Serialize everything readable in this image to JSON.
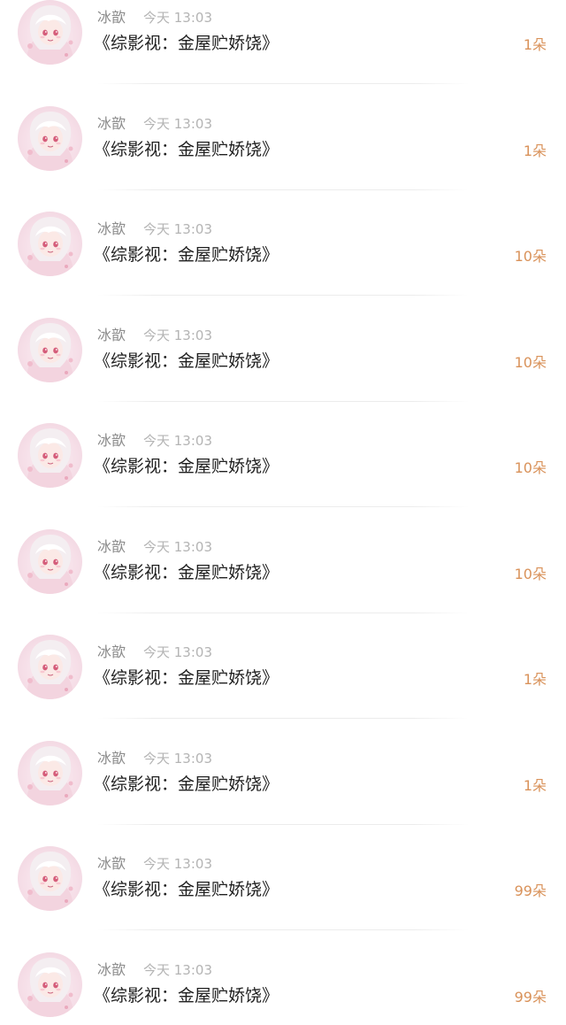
{
  "colors": {
    "background": "#ffffff",
    "name": "#8c8c8c",
    "time": "#b4b4b4",
    "title": "#1f1f1f",
    "gift": "#d9925a",
    "divider": "#ececec"
  },
  "gift_records": [
    {
      "avatar_icon": "anime-girl-avatar",
      "username": "冰歆",
      "time": "今天 13:03",
      "book_title": "《综影视：金屋贮娇饶》",
      "gift_count": "1朵"
    },
    {
      "avatar_icon": "anime-girl-avatar",
      "username": "冰歆",
      "time": "今天 13:03",
      "book_title": "《综影视：金屋贮娇饶》",
      "gift_count": "1朵"
    },
    {
      "avatar_icon": "anime-girl-avatar",
      "username": "冰歆",
      "time": "今天 13:03",
      "book_title": "《综影视：金屋贮娇饶》",
      "gift_count": "10朵"
    },
    {
      "avatar_icon": "anime-girl-avatar",
      "username": "冰歆",
      "time": "今天 13:03",
      "book_title": "《综影视：金屋贮娇饶》",
      "gift_count": "10朵"
    },
    {
      "avatar_icon": "anime-girl-avatar",
      "username": "冰歆",
      "time": "今天 13:03",
      "book_title": "《综影视：金屋贮娇饶》",
      "gift_count": "10朵"
    },
    {
      "avatar_icon": "anime-girl-avatar",
      "username": "冰歆",
      "time": "今天 13:03",
      "book_title": "《综影视：金屋贮娇饶》",
      "gift_count": "10朵"
    },
    {
      "avatar_icon": "anime-girl-avatar",
      "username": "冰歆",
      "time": "今天 13:03",
      "book_title": "《综影视：金屋贮娇饶》",
      "gift_count": "1朵"
    },
    {
      "avatar_icon": "anime-girl-avatar",
      "username": "冰歆",
      "time": "今天 13:03",
      "book_title": "《综影视：金屋贮娇饶》",
      "gift_count": "1朵"
    },
    {
      "avatar_icon": "anime-girl-avatar",
      "username": "冰歆",
      "time": "今天 13:03",
      "book_title": "《综影视：金屋贮娇饶》",
      "gift_count": "99朵"
    },
    {
      "avatar_icon": "anime-girl-avatar",
      "username": "冰歆",
      "time": "今天 13:03",
      "book_title": "《综影视：金屋贮娇饶》",
      "gift_count": "99朵"
    }
  ]
}
